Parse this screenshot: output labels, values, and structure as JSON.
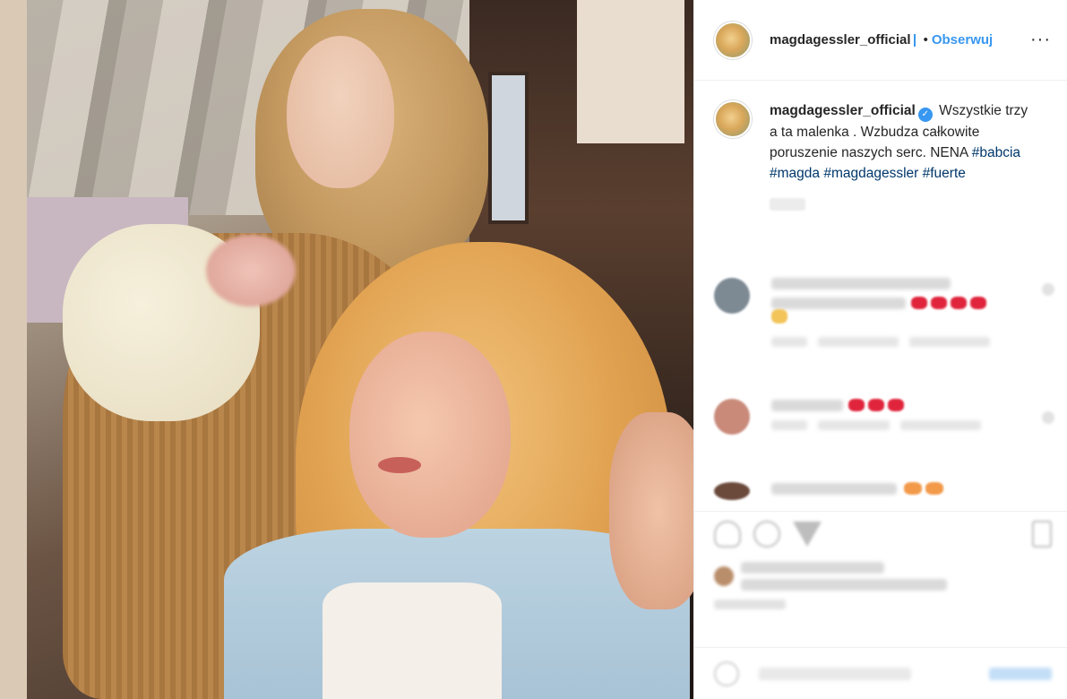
{
  "header": {
    "username": "magdagessler_official",
    "separator": "•",
    "follow_label": "Obserwuj",
    "more_label": "···"
  },
  "caption": {
    "username": "magdagessler_official",
    "verified_glyph": "✓",
    "text": "Wszystkie trzy a ta malenka . Wzbudza całkowite poruszenie naszych serc. NENA",
    "hashtags": [
      "#babcia",
      "#magda",
      "#magdagessler",
      "#fuerte"
    ]
  },
  "colors": {
    "accent": "#3897f0",
    "hashtag": "#00376b",
    "text": "#262626",
    "heart_emoji": "#e0243c"
  },
  "icons": [
    "heart-icon",
    "comment-icon",
    "share-icon",
    "save-icon",
    "emoji-icon",
    "more-icon",
    "verified-icon"
  ]
}
